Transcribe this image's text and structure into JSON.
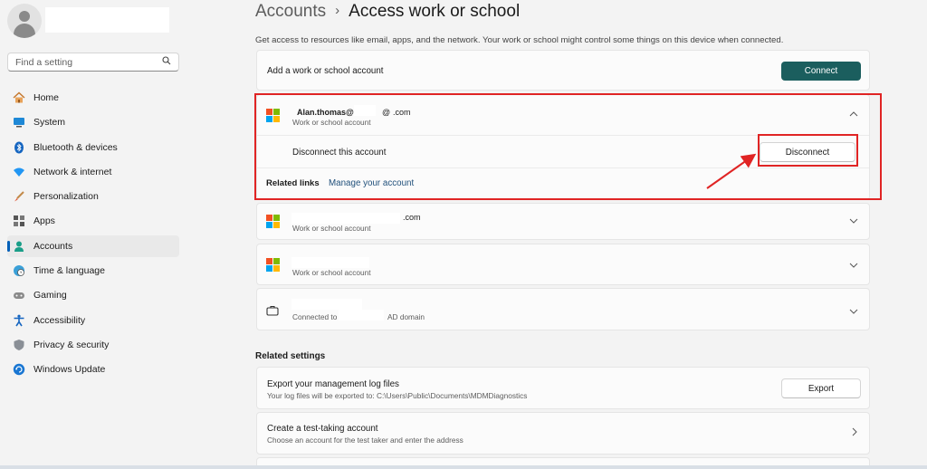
{
  "sidebar": {
    "search_placeholder": "Find a setting",
    "items": [
      {
        "label": "Home",
        "icon": "home-icon"
      },
      {
        "label": "System",
        "icon": "system-icon"
      },
      {
        "label": "Bluetooth & devices",
        "icon": "bluetooth-icon"
      },
      {
        "label": "Network & internet",
        "icon": "wifi-icon"
      },
      {
        "label": "Personalization",
        "icon": "brush-icon"
      },
      {
        "label": "Apps",
        "icon": "apps-icon"
      },
      {
        "label": "Accounts",
        "icon": "person-icon",
        "active": true
      },
      {
        "label": "Time & language",
        "icon": "globe-clock-icon"
      },
      {
        "label": "Gaming",
        "icon": "gamepad-icon"
      },
      {
        "label": "Accessibility",
        "icon": "accessibility-icon"
      },
      {
        "label": "Privacy & security",
        "icon": "shield-icon"
      },
      {
        "label": "Windows Update",
        "icon": "update-icon"
      }
    ]
  },
  "breadcrumb": {
    "parent": "Accounts",
    "separator": "›",
    "current": "Access work or school"
  },
  "description": "Get access to resources like email, apps, and the network. Your work or school might control some things on this device when connected.",
  "add_account": {
    "label": "Add a work or school account",
    "button": "Connect"
  },
  "accounts": [
    {
      "email_prefix": "Alan.thomas@",
      "email_mid": "@",
      "email_suffix": ".com",
      "type": "Work or school account",
      "expanded": true,
      "disconnect_label": "Disconnect this account",
      "disconnect_button": "Disconnect",
      "related_links_label": "Related links",
      "manage_link": "Manage your account"
    },
    {
      "email_suffix": ".com",
      "type": "Work or school account"
    },
    {
      "type": "Work or school account"
    },
    {
      "connected_prefix": "Connected to",
      "connected_suffix": "AD domain"
    }
  ],
  "related_settings": {
    "heading": "Related settings",
    "export": {
      "title": "Export your management log files",
      "subtitle": "Your log files will be exported to: C:\\Users\\Public\\Documents\\MDMDiagnostics",
      "button": "Export"
    },
    "test_account": {
      "title": "Create a test-taking account",
      "subtitle": "Choose an account for the test taker and enter the address"
    }
  },
  "colors": {
    "accent": "#1b5e5e",
    "annotation": "#e02424",
    "selection": "#005fb8"
  }
}
